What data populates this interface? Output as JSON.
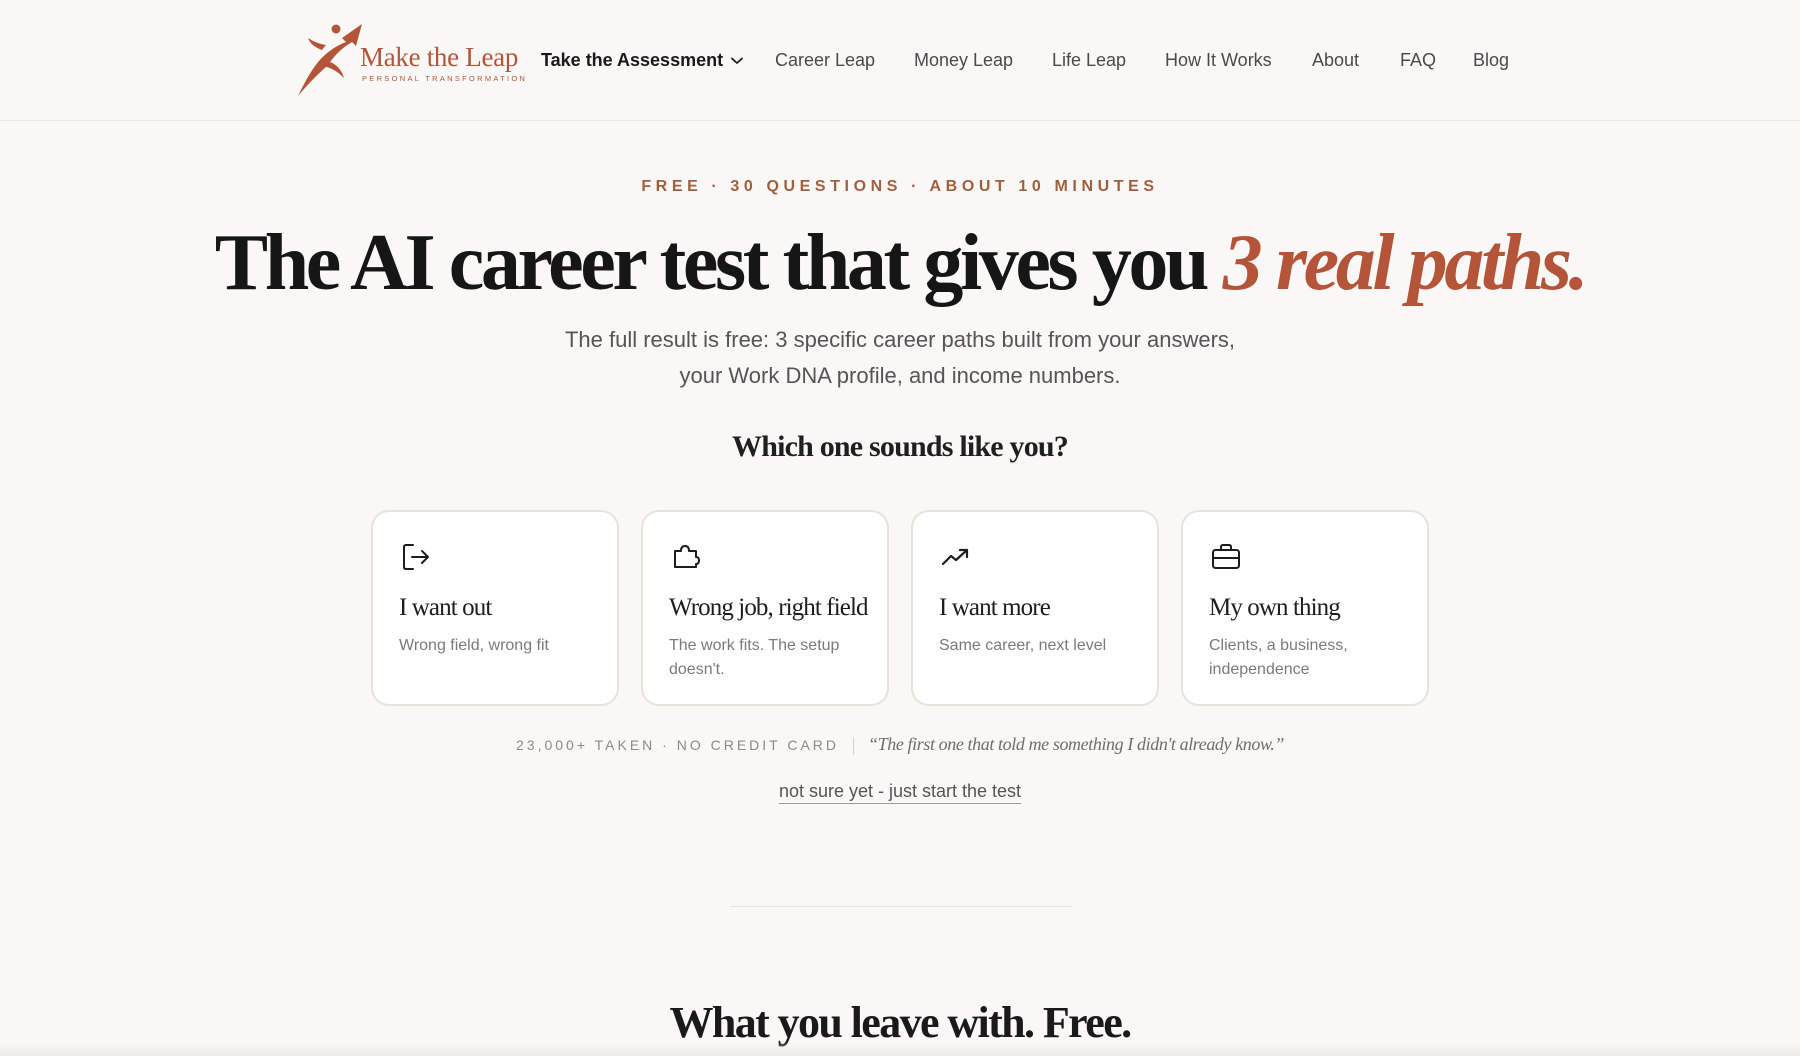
{
  "brand": {
    "name": "Make the Leap",
    "tagline": "PERSONAL TRANSFORMATION",
    "color": "#b4553a"
  },
  "nav": {
    "assessment": "Take the Assessment",
    "items": [
      "Career Leap",
      "Money Leap",
      "Life Leap",
      "How It Works",
      "About",
      "FAQ",
      "Blog"
    ]
  },
  "hero": {
    "eyebrow": "FREE · 30 QUESTIONS · ABOUT 10 MINUTES",
    "headline": "The AI career test that gives you",
    "headline_accent": "3 real paths.",
    "subtitle_line1": "The full result is free: 3 specific career paths built from your answers,",
    "subtitle_line2": "your Work DNA profile, and income numbers.",
    "question": "Which one sounds like you?"
  },
  "cards": [
    {
      "icon": "exit-door-icon",
      "title": "I want out",
      "desc": "Wrong field, wrong fit"
    },
    {
      "icon": "puzzle-piece-icon",
      "title": "Wrong job, right field",
      "desc": "The work fits. The setup doesn't."
    },
    {
      "icon": "trending-up-icon",
      "title": "I want more",
      "desc": "Same career, next level"
    },
    {
      "icon": "briefcase-icon",
      "title": "My own thing",
      "desc": "Clients, a business, independence"
    }
  ],
  "proof": {
    "stats": "23,000+ TAKEN · NO CREDIT CARD",
    "quote": "“The first one that told me something I didn't already know.”"
  },
  "start_link": "not sure yet - just start the test",
  "next_section_title": "What you leave with. Free."
}
